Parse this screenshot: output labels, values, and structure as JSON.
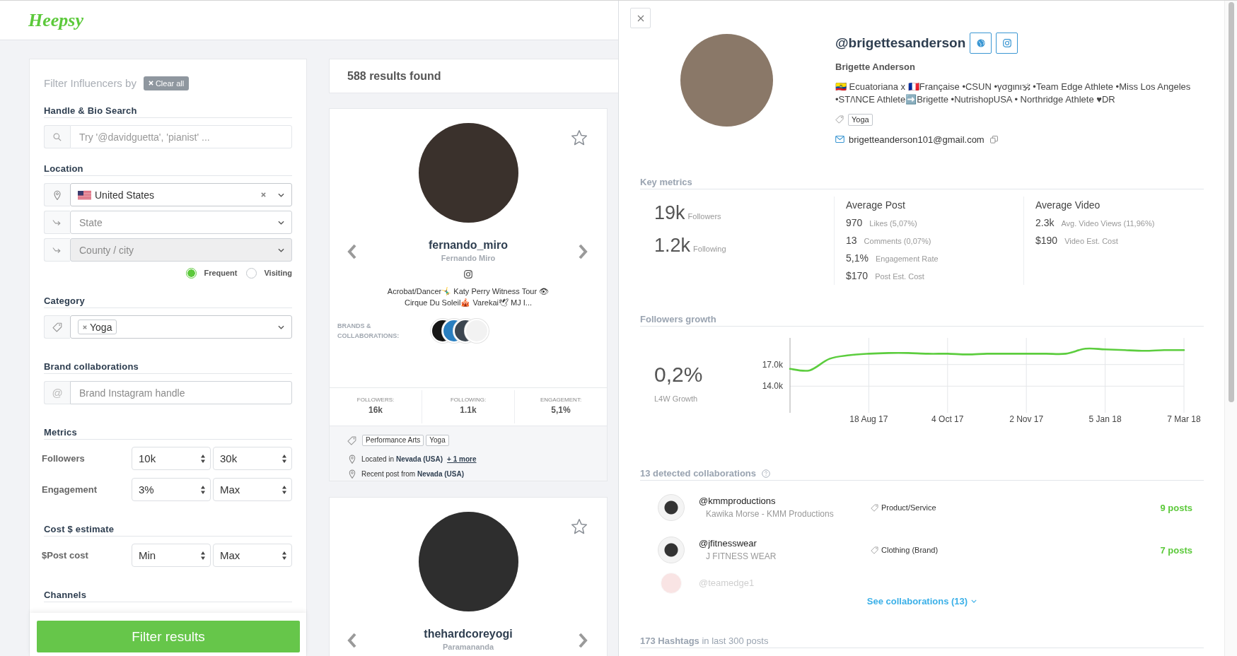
{
  "header": {
    "logo": "Heepsy"
  },
  "filters": {
    "title": "Filter Influencers by",
    "clear_label": "Clear all",
    "handle_search": {
      "heading": "Handle & Bio Search",
      "placeholder": "Try '@davidguetta', 'pianist' ..."
    },
    "location": {
      "heading": "Location",
      "country": "United States",
      "state": {
        "placeholder": "State",
        "disabled": false
      },
      "city": {
        "placeholder": "County / city",
        "disabled": true
      },
      "modes": [
        {
          "label": "Frequent",
          "selected": true
        },
        {
          "label": "Visiting",
          "selected": false
        }
      ]
    },
    "category": {
      "heading": "Category",
      "chips": [
        "Yoga"
      ]
    },
    "brand": {
      "heading": "Brand collaborations",
      "addon": "@",
      "placeholder": "Brand Instagram handle"
    },
    "metrics": {
      "heading": "Metrics",
      "rows": [
        {
          "label": "Followers",
          "min": "10k",
          "max": "30k"
        },
        {
          "label": "Engagement",
          "min": "3%",
          "max": "Max"
        }
      ]
    },
    "cost": {
      "heading": "Cost $ estimate",
      "rows": [
        {
          "label": "$Post cost",
          "min": "Min",
          "max": "Max"
        }
      ]
    },
    "channels": {
      "heading": "Channels"
    },
    "submit": "Filter results"
  },
  "results": {
    "count": "588 results found",
    "cards": [
      {
        "handle": "fernando_miro",
        "name": "Fernando Miro",
        "favorite": false,
        "bio": "Acrobat/Dancer🤸‍♂️ Katy Perry Witness Tour 👁 Cirque Du Soleil🎪 Varekai🕊 MJ I...",
        "brands_label": "BRANDS & COLLABORATIONS:",
        "stats": [
          {
            "label": "FOLLOWERS:",
            "value": "16k"
          },
          {
            "label": "FOLLOWING:",
            "value": "1.1k"
          },
          {
            "label": "ENGAGEMENT:",
            "value": "5,1%"
          }
        ],
        "tags": [
          "Performance Arts",
          "Yoga"
        ],
        "location": "Located in **Nevada (USA)**",
        "location_more": "+ 1 more",
        "recent_post": "Recent post from **Nevada (USA)**"
      },
      {
        "handle": "thehardcoreyogi",
        "name": "Paramananda",
        "favorite": false
      }
    ]
  },
  "profile": {
    "handle": "@brigettesanderson",
    "name": "Brigette Anderson",
    "bio": "🇪🇨 Ecuatoriana x 🇫🇷Française •CSUN •γσgιnι🕉 •Team Edge Athlete •Miss Los Angeles •ST/\\NCE Athlete➡️Brigette •NutrishopUSA • Northridge Athlete ♥DR",
    "tags": [
      "Yoga"
    ],
    "email": "brigetteanderson101@gmail.com"
  },
  "key_metrics": {
    "title": "Key metrics",
    "totals": [
      {
        "value": "19k",
        "label": "Followers"
      },
      {
        "value": "1.2k",
        "label": "Following"
      }
    ],
    "groups": [
      {
        "title": "Average Post",
        "rows": [
          {
            "value": "970",
            "label": "Likes (5,07%)"
          },
          {
            "value": "13",
            "label": "Comments (0,07%)"
          },
          {
            "value": "5,1%",
            "label": "Engagement Rate"
          },
          {
            "value": "$170",
            "label": "Post Est. Cost"
          }
        ]
      },
      {
        "title": "Average Video",
        "rows": [
          {
            "value": "2.3k",
            "label": "Avg. Video Views (11,96%)"
          },
          {
            "value": "$190",
            "label": "Video Est. Cost"
          }
        ]
      }
    ]
  },
  "growth": {
    "title": "Followers growth",
    "value": "0,2%",
    "label": "L4W Growth",
    "chart_data": {
      "type": "line",
      "grid": true,
      "categories": [
        null,
        null,
        null,
        null,
        "18 Aug 17",
        null,
        null,
        null,
        "4 Oct 17",
        null,
        null,
        null,
        "2 Nov 17",
        null,
        null,
        null,
        "5 Jan 18",
        null,
        null,
        null,
        "7 Mar 18"
      ],
      "series": [
        {
          "color": "#5ccd3e",
          "values": [
            16400,
            16200,
            17800,
            18300,
            18500,
            18600,
            18600,
            18500,
            18500,
            18400,
            18500,
            18500,
            18500,
            18500,
            18500,
            19200,
            19100,
            19000,
            18900,
            19000,
            19000
          ]
        }
      ],
      "ylim": [
        10300,
        20700
      ],
      "yticks": [
        {
          "value": 14000,
          "label": "14.0k"
        },
        {
          "value": 17000,
          "label": "17.0k"
        }
      ]
    }
  },
  "collaborations": {
    "title": "13 detected collaborations",
    "rows": [
      {
        "handle": "@kmmproductions",
        "name": "Kawika Morse - KMM Productions",
        "category": "Product/Service",
        "posts": "9 posts",
        "faded": false
      },
      {
        "handle": "@jfitnesswear",
        "name": "J FITNESS WEAR",
        "category": "Clothing (Brand)",
        "posts": "7 posts",
        "faded": false
      },
      {
        "handle": "@teamedge1",
        "faded": true
      }
    ],
    "see_all": "See collaborations (13)"
  },
  "hashtags": {
    "summary": "**173 Hashtags** in last 300 posts"
  }
}
